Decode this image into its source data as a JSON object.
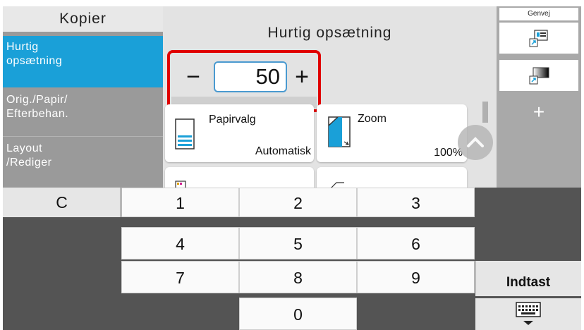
{
  "sidebar": {
    "title": "Kopier",
    "items": [
      {
        "label": "Hurtig\nopsætning",
        "active": true
      },
      {
        "label": "Orig./Papir/\nEfterbehan.",
        "active": false
      },
      {
        "label": "Layout\n/Rediger",
        "active": false
      }
    ]
  },
  "main": {
    "title": "Hurtig opsætning",
    "stepper": {
      "minus": "−",
      "value": "50",
      "plus": "+"
    },
    "tiles": [
      {
        "label": "Papirvalg",
        "value": "Automatisk",
        "icon": "paper-tray-icon"
      },
      {
        "label": "Zoom",
        "value": "100%",
        "icon": "zoom-icon"
      }
    ]
  },
  "shortcuts": {
    "title": "Genvej",
    "add_label": "+"
  },
  "keypad": {
    "clear": "C",
    "keys": [
      "1",
      "2",
      "3",
      "4",
      "5",
      "6",
      "7",
      "8",
      "9",
      "0"
    ],
    "enter": "Indtast",
    "keyboard_icon": "keyboard-icon"
  },
  "colors": {
    "accent": "#1aa0d8",
    "highlight": "#e00000",
    "keypad_bg": "#545454"
  }
}
